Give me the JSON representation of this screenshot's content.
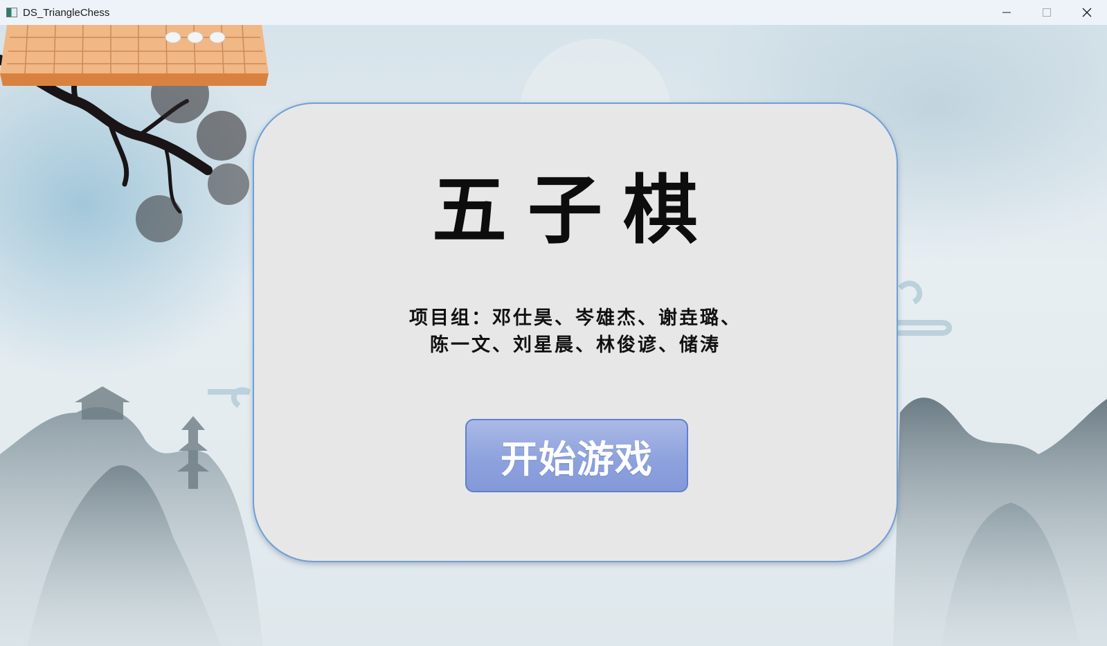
{
  "window": {
    "title": "DS_TriangleChess",
    "icon": "app-window-icon",
    "controls": [
      "minimize-icon",
      "maximize-icon",
      "close-icon"
    ]
  },
  "main": {
    "game_title": "五子棋",
    "team_line1": "项目组：邓仕昊、岑雄杰、谢垚璐、",
    "team_line2": "陈一文、刘星晨、林俊谚、储涛",
    "start_button": "开始游戏"
  },
  "colors": {
    "card_background": "#e7e7e7",
    "card_border": "#6f9fd6",
    "button_fill": "#8ea2dd",
    "button_border": "#5f7fd0",
    "button_text": "#ffffff",
    "title_text": "#0d0d0d"
  }
}
